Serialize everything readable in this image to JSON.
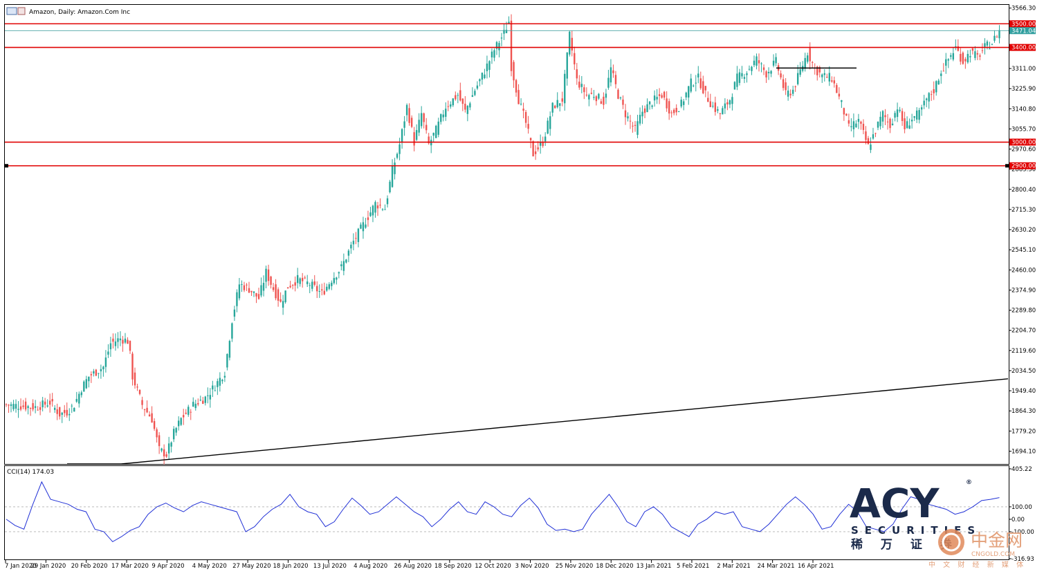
{
  "header": {
    "title": "Amazon, Daily:  Amazon.Com Inc"
  },
  "indicator": {
    "label": "CCI(14) 174.03",
    "axis_labels": [
      "405.22",
      "100.00",
      "0.00",
      "-100.00",
      "-316.93"
    ],
    "axis_values": [
      405.22,
      100,
      0,
      -100,
      -316.93
    ]
  },
  "price_tags": {
    "current": "3471.04",
    "level_3500": "3500.00",
    "level_3400": "3400.00",
    "level_3000": "3000.00",
    "level_2900": "2900.00"
  },
  "logo": {
    "name": "ACY",
    "registered": "®",
    "tagline": "SECURITIES",
    "chinese": "稀 万 证 券"
  },
  "watermark": {
    "cn": "中金网",
    "en": "CNGOLD.COM",
    "sub": "中 文 财 经 新 媒 体"
  },
  "colors": {
    "bull": "#26a69a",
    "bear": "#ef5350",
    "resistance": "#e00000",
    "cci": "#1f2fd6",
    "trend": "#000000",
    "logo_navy": "#1b2a4a",
    "watermark": "#e3a07a"
  },
  "chart_data": {
    "type": "candlestick",
    "title": "Amazon, Daily:  Amazon.Com Inc",
    "ylim": [
      1640,
      3580
    ],
    "y_ticks": [
      "3566.30",
      "3481.60",
      "3396.10",
      "3311.00",
      "3225.90",
      "3140.80",
      "3055.70",
      "2970.60",
      "2885.50",
      "2800.40",
      "2715.30",
      "2630.20",
      "2545.10",
      "2460.00",
      "2374.90",
      "2289.80",
      "2204.70",
      "2119.60",
      "2034.50",
      "1949.40",
      "1864.30",
      "1779.20",
      "1694.10"
    ],
    "y_tick_values": [
      3566.3,
      3481.6,
      3396.1,
      3311,
      3225.9,
      3140.8,
      3055.7,
      2970.6,
      2885.5,
      2800.4,
      2715.3,
      2630.2,
      2545.1,
      2460,
      2374.9,
      2289.8,
      2204.7,
      2119.6,
      2034.5,
      1949.4,
      1864.3,
      1779.2,
      1694.1
    ],
    "x_labels": [
      "7 Jan 2020",
      "29 Jan 2020",
      "20 Feb 2020",
      "17 Mar 2020",
      "9 Apr 2020",
      "4 May 2020",
      "27 May 2020",
      "18 Jun 2020",
      "13 Jul 2020",
      "4 Aug 2020",
      "26 Aug 2020",
      "18 Sep 2020",
      "12 Oct 2020",
      "3 Nov 2020",
      "25 Nov 2020",
      "18 Dec 2020",
      "13 Jan 2021",
      "5 Feb 2021",
      "2 Mar 2021",
      "24 Mar 2021",
      "16 Apr 2021"
    ],
    "horizontal_levels": [
      3500,
      3400,
      3000,
      2900
    ],
    "current_price": 3471.04,
    "close_path": [
      [
        0,
        1890
      ],
      [
        12,
        1880
      ],
      [
        18,
        1900
      ],
      [
        22,
        1850
      ],
      [
        25,
        1860
      ],
      [
        28,
        1890
      ],
      [
        31,
        1960
      ],
      [
        34,
        2010
      ],
      [
        40,
        2050
      ],
      [
        43,
        2150
      ],
      [
        47,
        2170
      ],
      [
        50,
        2160
      ],
      [
        51,
        2100
      ],
      [
        52,
        2010
      ],
      [
        56,
        1890
      ],
      [
        60,
        1830
      ],
      [
        63,
        1700
      ],
      [
        66,
        1680
      ],
      [
        69,
        1770
      ],
      [
        72,
        1830
      ],
      [
        77,
        1890
      ],
      [
        82,
        1920
      ],
      [
        86,
        1970
      ],
      [
        90,
        2030
      ],
      [
        93,
        2250
      ],
      [
        96,
        2400
      ],
      [
        100,
        2380
      ],
      [
        104,
        2340
      ],
      [
        107,
        2450
      ],
      [
        110,
        2380
      ],
      [
        113,
        2320
      ],
      [
        116,
        2390
      ],
      [
        120,
        2420
      ],
      [
        125,
        2400
      ],
      [
        130,
        2360
      ],
      [
        134,
        2420
      ],
      [
        138,
        2470
      ],
      [
        143,
        2580
      ],
      [
        147,
        2650
      ],
      [
        152,
        2740
      ],
      [
        156,
        2720
      ],
      [
        159,
        2880
      ],
      [
        162,
        2990
      ],
      [
        165,
        3150
      ],
      [
        168,
        3000
      ],
      [
        171,
        3120
      ],
      [
        174,
        2990
      ],
      [
        177,
        3050
      ],
      [
        181,
        3150
      ],
      [
        186,
        3200
      ],
      [
        189,
        3130
      ],
      [
        193,
        3220
      ],
      [
        197,
        3300
      ],
      [
        201,
        3390
      ],
      [
        205,
        3460
      ],
      [
        207,
        3510
      ],
      [
        208,
        3320
      ],
      [
        211,
        3180
      ],
      [
        214,
        3080
      ],
      [
        217,
        2950
      ],
      [
        221,
        3000
      ],
      [
        225,
        3150
      ],
      [
        229,
        3180
      ],
      [
        232,
        3450
      ],
      [
        235,
        3260
      ],
      [
        239,
        3200
      ],
      [
        242,
        3200
      ],
      [
        246,
        3170
      ],
      [
        249,
        3310
      ],
      [
        252,
        3200
      ],
      [
        255,
        3120
      ],
      [
        259,
        3050
      ],
      [
        262,
        3130
      ],
      [
        266,
        3170
      ],
      [
        270,
        3200
      ],
      [
        274,
        3120
      ],
      [
        278,
        3160
      ],
      [
        282,
        3250
      ],
      [
        285,
        3270
      ],
      [
        288,
        3200
      ],
      [
        291,
        3150
      ],
      [
        294,
        3120
      ],
      [
        298,
        3180
      ],
      [
        301,
        3270
      ],
      [
        305,
        3300
      ],
      [
        309,
        3350
      ],
      [
        313,
        3290
      ],
      [
        317,
        3340
      ],
      [
        321,
        3200
      ],
      [
        324,
        3220
      ],
      [
        327,
        3300
      ],
      [
        330,
        3380
      ],
      [
        333,
        3310
      ],
      [
        336,
        3280
      ],
      [
        340,
        3270
      ],
      [
        344,
        3160
      ],
      [
        347,
        3060
      ],
      [
        351,
        3090
      ],
      [
        355,
        2980
      ],
      [
        358,
        3050
      ],
      [
        361,
        3120
      ],
      [
        364,
        3070
      ],
      [
        367,
        3150
      ],
      [
        370,
        3060
      ],
      [
        373,
        3100
      ],
      [
        376,
        3120
      ],
      [
        379,
        3180
      ],
      [
        382,
        3220
      ],
      [
        385,
        3300
      ],
      [
        388,
        3350
      ],
      [
        391,
        3400
      ],
      [
        394,
        3340
      ],
      [
        397,
        3380
      ],
      [
        400,
        3360
      ],
      [
        403,
        3400
      ],
      [
        406,
        3420
      ],
      [
        409,
        3471
      ]
    ],
    "trendline": [
      [
        175,
        1640
      ],
      [
        1457,
        2000
      ]
    ],
    "support_segment": {
      "x1": 1122,
      "x2": 1238,
      "y": 3313
    },
    "cci": [
      0,
      -50,
      -80,
      120,
      300,
      160,
      140,
      120,
      80,
      60,
      -80,
      -100,
      -180,
      -140,
      -90,
      -60,
      40,
      100,
      130,
      90,
      60,
      110,
      140,
      120,
      100,
      80,
      60,
      -100,
      -60,
      20,
      80,
      120,
      200,
      100,
      60,
      40,
      -60,
      -20,
      80,
      170,
      110,
      40,
      60,
      120,
      180,
      120,
      60,
      20,
      -60,
      0,
      80,
      140,
      60,
      40,
      140,
      100,
      40,
      20,
      110,
      170,
      90,
      -40,
      -90,
      -80,
      -100,
      -80,
      40,
      120,
      200,
      100,
      -20,
      -60,
      60,
      100,
      40,
      -60,
      -100,
      -140,
      -40,
      0,
      60,
      40,
      60,
      -60,
      -80,
      -100,
      -40,
      40,
      120,
      180,
      120,
      40,
      -80,
      -60,
      40,
      120,
      60,
      -60,
      -80,
      -100,
      -40,
      80,
      180,
      160,
      120,
      100,
      80,
      40,
      60,
      100,
      150,
      160,
      174.03
    ]
  }
}
